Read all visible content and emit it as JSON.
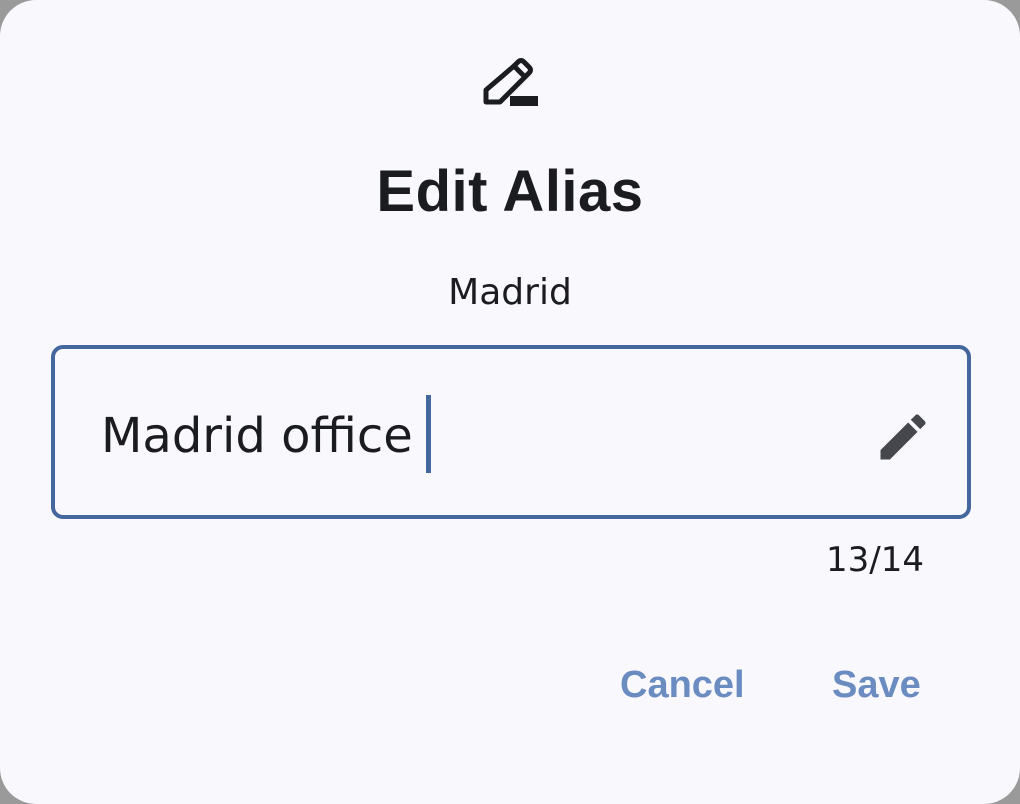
{
  "dialog": {
    "icon": "edit-note-icon",
    "title": "Edit Alias",
    "subtitle": "Madrid"
  },
  "alias_field": {
    "value": "Madrid office",
    "trailing_icon": "pencil-icon",
    "counter": "13/14"
  },
  "actions": {
    "cancel_label": "Cancel",
    "save_label": "Save"
  },
  "colors": {
    "surface": "#f8f8fd",
    "on_surface": "#1b1c20",
    "primary": "#44679e",
    "button_text": "#6b8cc1"
  }
}
